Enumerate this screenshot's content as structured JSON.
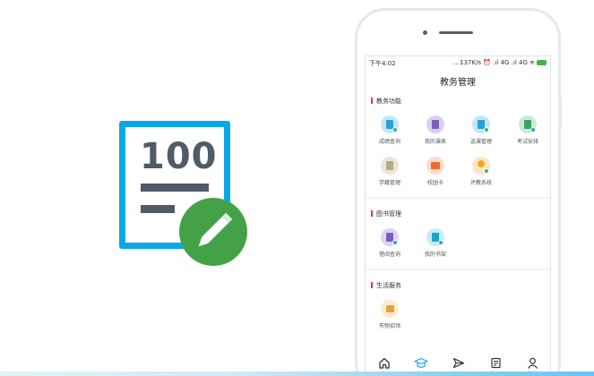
{
  "illustration": {
    "score": "100",
    "icon": "edit-pencil-icon",
    "colors": {
      "frame": "#0aa7e8",
      "ink": "#4f5b66",
      "badge": "#44a148"
    }
  },
  "status_bar": {
    "time": "下午4:02",
    "right": "...137K/s ⏰ .ıl 4G .ıl 4G ≋"
  },
  "header": {
    "title": "教务管理"
  },
  "sections": [
    {
      "label": "教务功能",
      "items": [
        {
          "label": "成绩查询",
          "icon": "grade-query-icon",
          "color": "#c4e6f7",
          "accent": "#2aa1dc",
          "badge": "#3cb371"
        },
        {
          "label": "我的课表",
          "icon": "schedule-icon",
          "color": "#d9d0ee",
          "accent": "#7d5bc4",
          "badge": ""
        },
        {
          "label": "选课管理",
          "icon": "course-select-icon",
          "color": "#c4e6f7",
          "accent": "#2aa1dc",
          "badge": "#3cb371"
        },
        {
          "label": "考试安排",
          "icon": "exam-icon",
          "color": "#cde9d5",
          "accent": "#3aa55c",
          "badge": "#2aa1dc"
        },
        {
          "label": "学籍管理",
          "icon": "student-record-icon",
          "color": "#ece6d8",
          "accent": "#b7a88b",
          "badge": ""
        },
        {
          "label": "校园卡",
          "icon": "campus-card-icon",
          "color": "#f9dccd",
          "accent": "#ef6c2b",
          "badge": ""
        },
        {
          "label": "评教系统",
          "icon": "evaluation-icon",
          "color": "#fbe7c6",
          "accent": "#f5a623",
          "badge": "#3cb371"
        }
      ]
    },
    {
      "label": "图书管理",
      "items": [
        {
          "label": "借阅查询",
          "icon": "borrow-query-icon",
          "color": "#ddd5ef",
          "accent": "#7d5bc4",
          "badge": "#2aa1dc"
        },
        {
          "label": "我的书架",
          "icon": "bookshelf-icon",
          "color": "#c9ecf4",
          "accent": "#19a7c9",
          "badge": "#2aa1dc"
        }
      ]
    },
    {
      "label": "生活服务",
      "items": [
        {
          "label": "失物招领",
          "icon": "lost-found-icon",
          "color": "#fbecd3",
          "accent": "#e6a23c",
          "badge": ""
        }
      ]
    }
  ],
  "tabbar": [
    {
      "label": "首页",
      "icon": "home-icon",
      "active": false
    },
    {
      "label": "教务",
      "icon": "graduation-cap-icon",
      "active": true
    },
    {
      "label": "社区",
      "icon": "paper-plane-icon",
      "active": false
    },
    {
      "label": "快讯",
      "icon": "news-icon",
      "active": false
    },
    {
      "label": "我的",
      "icon": "user-icon",
      "active": false
    }
  ]
}
